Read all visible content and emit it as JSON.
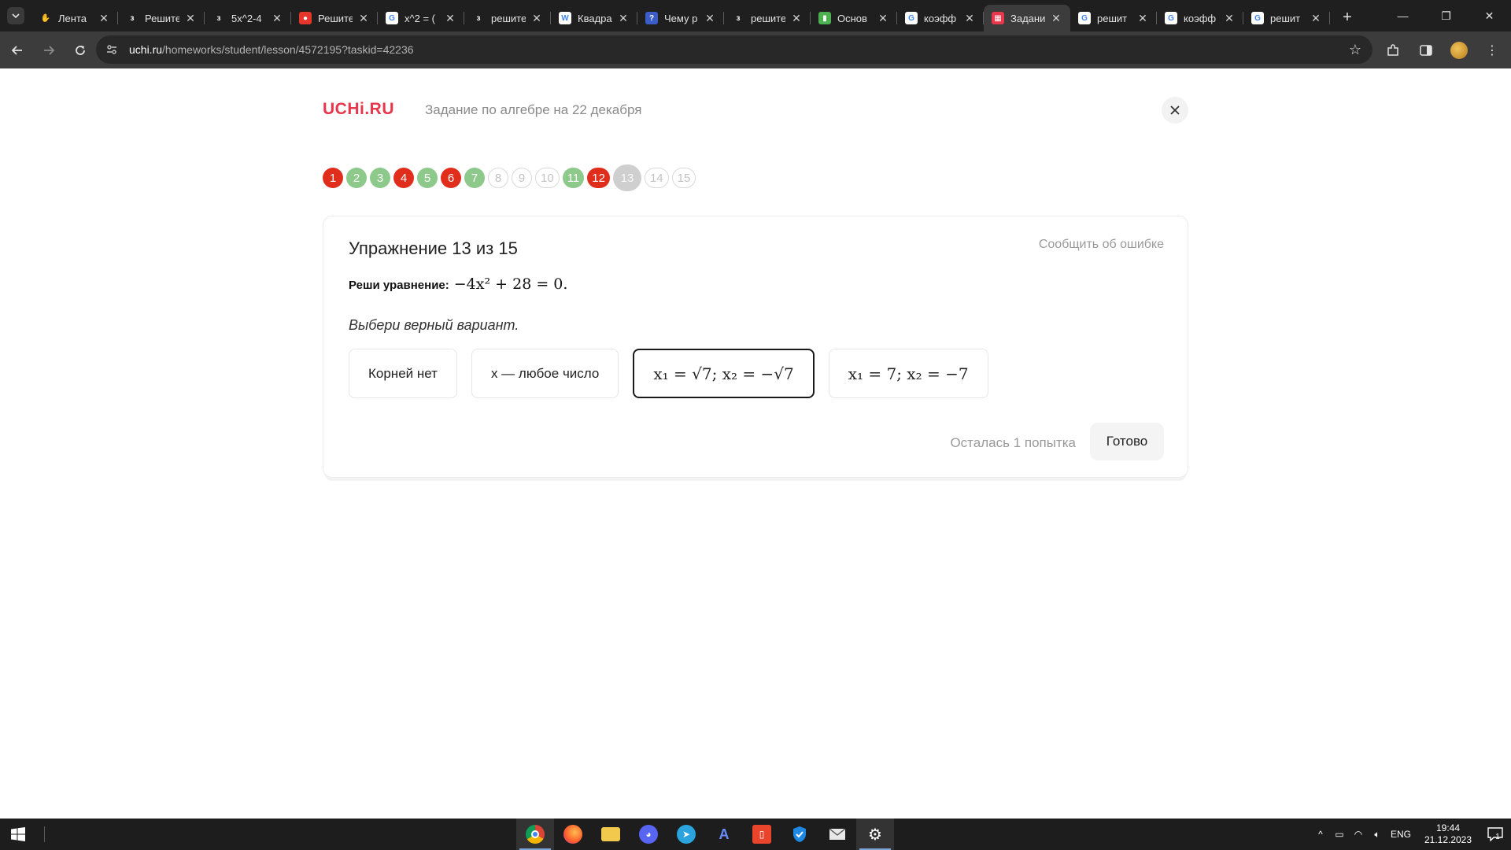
{
  "browser": {
    "tabs": [
      {
        "title": "Лента",
        "favicon_color": "#1f1f1f",
        "favicon_glyph": "✋"
      },
      {
        "title": "Решите",
        "favicon_color": "#1f1f1f",
        "favicon_glyph": "з"
      },
      {
        "title": "5x^2-4",
        "favicon_color": "#1f1f1f",
        "favicon_glyph": "з"
      },
      {
        "title": "Решите",
        "favicon_color": "#e6352b",
        "favicon_glyph": "●"
      },
      {
        "title": "x^2 = (",
        "favicon_color": "#ffffff",
        "favicon_glyph": "G"
      },
      {
        "title": "решите",
        "favicon_color": "#1f1f1f",
        "favicon_glyph": "з"
      },
      {
        "title": "Квадра",
        "favicon_color": "#ffffff",
        "favicon_glyph": "W"
      },
      {
        "title": "Чему р",
        "favicon_color": "#3a5dc8",
        "favicon_glyph": "?"
      },
      {
        "title": "решите",
        "favicon_color": "#1f1f1f",
        "favicon_glyph": "з"
      },
      {
        "title": "Основ",
        "favicon_color": "#4caf50",
        "favicon_glyph": "▮"
      },
      {
        "title": "коэфф",
        "favicon_color": "#ffffff",
        "favicon_glyph": "G"
      },
      {
        "title": "Задани",
        "favicon_color": "#e8364c",
        "favicon_glyph": "▦",
        "active": true
      },
      {
        "title": "решит",
        "favicon_color": "#ffffff",
        "favicon_glyph": "G"
      },
      {
        "title": "коэфф",
        "favicon_color": "#ffffff",
        "favicon_glyph": "G"
      },
      {
        "title": "решит",
        "favicon_color": "#ffffff",
        "favicon_glyph": "G"
      }
    ],
    "url_host": "uchi.ru",
    "url_path": "/homeworks/student/lesson/4572195?taskid=42236"
  },
  "header": {
    "logo": "UCHi.RU",
    "title": "Задание по алгебре на 22 декабря"
  },
  "progress": [
    {
      "n": "1",
      "state": "red"
    },
    {
      "n": "2",
      "state": "green"
    },
    {
      "n": "3",
      "state": "green"
    },
    {
      "n": "4",
      "state": "red"
    },
    {
      "n": "5",
      "state": "green"
    },
    {
      "n": "6",
      "state": "red"
    },
    {
      "n": "7",
      "state": "green"
    },
    {
      "n": "8",
      "state": "empty"
    },
    {
      "n": "9",
      "state": "empty"
    },
    {
      "n": "10",
      "state": "empty"
    },
    {
      "n": "11",
      "state": "green"
    },
    {
      "n": "12",
      "state": "red"
    },
    {
      "n": "13",
      "state": "current"
    },
    {
      "n": "14",
      "state": "empty"
    },
    {
      "n": "15",
      "state": "empty"
    }
  ],
  "exercise": {
    "title": "Упражнение 13 из 15",
    "report_link": "Сообщить об ошибке",
    "task_label": "Реши уравнение:",
    "equation": "−4x² + 28 = 0.",
    "hint": "Выбери верный вариант.",
    "options": [
      {
        "label": "Корней нет",
        "math": false,
        "selected": false
      },
      {
        "label": "x — любое число",
        "math": false,
        "selected": false
      },
      {
        "label": "x₁ = √7;  x₂ = −√7",
        "math": true,
        "selected": true
      },
      {
        "label": "x₁ = 7;  x₂ = −7",
        "math": true,
        "selected": false
      }
    ],
    "attempts_left": "Осталась 1 попытка",
    "done_button": "Готово"
  },
  "taskbar": {
    "language": "ENG",
    "time": "19:44",
    "date": "21.12.2023",
    "notification_count": "1"
  },
  "colors": {
    "brand": "#e8364c",
    "wrong": "#e02d1c",
    "correct": "#8cc98a"
  }
}
